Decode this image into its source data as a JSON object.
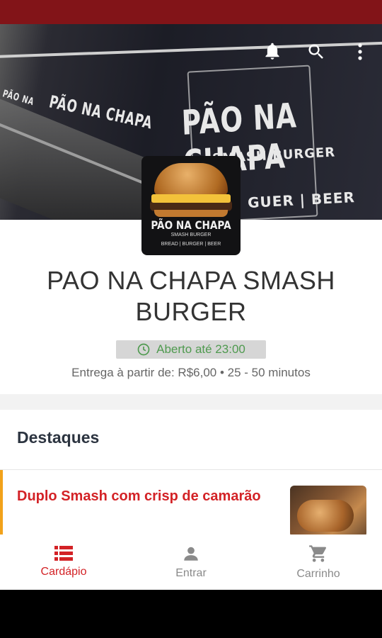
{
  "store": {
    "name": "PAO NA CHAPA SMASH BURGER",
    "status": "Aberto até 23:00",
    "delivery_info": "Entrega à partir de: R$6,00 • 25 - 50 minutos",
    "logo_text": "PÃO NA CHAPA",
    "logo_subtitle": "SMASH BURGER",
    "logo_tagline": "BREAD | BURGER | BEER"
  },
  "banner": {
    "sign_main": "PÃO NA CHAPA",
    "sign_sub1": "SMASH BURGER",
    "sign_sub2": "GUER | BEER",
    "sign_small1": "PÃO NA CHAPA",
    "sign_small2": "PÃO NA"
  },
  "toolbar_icons": [
    "bell-icon",
    "search-icon",
    "more-vert-icon"
  ],
  "highlights": {
    "title": "Destaques",
    "items": [
      {
        "name": "Duplo Smash com crisp de camarão"
      }
    ]
  },
  "bottom_nav": {
    "items": [
      {
        "label": "Cardápio",
        "icon": "menu-list-icon",
        "active": true
      },
      {
        "label": "Entrar",
        "icon": "person-icon",
        "active": false
      },
      {
        "label": "Carrinho",
        "icon": "cart-icon",
        "active": false
      }
    ]
  },
  "colors": {
    "status_bar": "#821418",
    "accent_red": "#d32226",
    "open_green": "#4f9a4f",
    "highlight_accent": "#f2a21b"
  }
}
